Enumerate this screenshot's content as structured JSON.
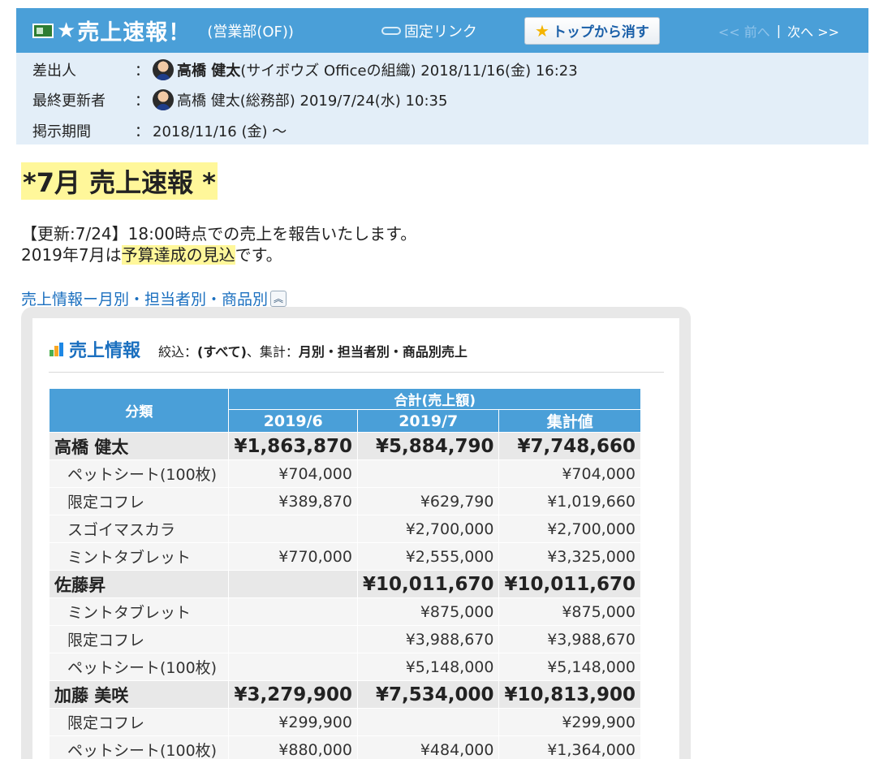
{
  "header": {
    "star": "★",
    "title": "売上速報！",
    "dept": "(営業部(OF))",
    "permalink": "固定リンク",
    "remove_button": "トップから消す",
    "prev": "<< 前へ",
    "separator": "|",
    "next": "次へ >>"
  },
  "meta": {
    "sender_label": "差出人",
    "sender_name": "高橋 健太",
    "sender_detail": "(サイボウズ Officeの組織) 2018/11/16(金) 16:23",
    "updater_label": "最終更新者",
    "updater_detail": "高橋 健太(総務部) 2019/7/24(水) 10:35",
    "period_label": "掲示期間",
    "period_value": "2018/11/16 (金) 〜",
    "colon": "："
  },
  "body": {
    "headline": "*7月 売上速報 *",
    "line1": "【更新:7/24】18:00時点での売上を報告いたします。",
    "line2_prefix": "2019年7月は",
    "line2_highlight": "予算達成の見込",
    "line2_suffix": "です。",
    "section_link": "売上情報ー月別・担当者別・商品別"
  },
  "panel": {
    "title": "売上情報",
    "filter_label": "絞込：",
    "filter_value": "(すべて)",
    "agg_label": "、集計：",
    "agg_value": "月別・担当者別・商品別売上"
  },
  "table": {
    "cat_header": "分類",
    "group_header": "合計(売上額)",
    "columns": [
      "2019/6",
      "2019/7",
      "集計値"
    ],
    "rows": [
      {
        "type": "person",
        "label": "高橋 健太",
        "v": [
          "¥1,863,870",
          "¥5,884,790",
          "¥7,748,660"
        ]
      },
      {
        "type": "item",
        "label": "ペットシート(100枚)",
        "v": [
          "¥704,000",
          "",
          "¥704,000"
        ]
      },
      {
        "type": "item",
        "label": "限定コフレ",
        "v": [
          "¥389,870",
          "¥629,790",
          "¥1,019,660"
        ]
      },
      {
        "type": "item",
        "label": "スゴイマスカラ",
        "v": [
          "",
          "¥2,700,000",
          "¥2,700,000"
        ]
      },
      {
        "type": "item",
        "label": "ミントタブレット",
        "v": [
          "¥770,000",
          "¥2,555,000",
          "¥3,325,000"
        ]
      },
      {
        "type": "person",
        "label": "佐藤昇",
        "v": [
          "",
          "¥10,011,670",
          "¥10,011,670"
        ]
      },
      {
        "type": "item",
        "label": "ミントタブレット",
        "v": [
          "",
          "¥875,000",
          "¥875,000"
        ]
      },
      {
        "type": "item",
        "label": "限定コフレ",
        "v": [
          "",
          "¥3,988,670",
          "¥3,988,670"
        ]
      },
      {
        "type": "item",
        "label": "ペットシート(100枚)",
        "v": [
          "",
          "¥5,148,000",
          "¥5,148,000"
        ]
      },
      {
        "type": "person",
        "label": "加藤 美咲",
        "v": [
          "¥3,279,900",
          "¥7,534,000",
          "¥10,813,900"
        ]
      },
      {
        "type": "item",
        "label": "限定コフレ",
        "v": [
          "¥299,900",
          "",
          "¥299,900"
        ]
      },
      {
        "type": "item",
        "label": "ペットシート(100枚)",
        "v": [
          "¥880,000",
          "¥484,000",
          "¥1,364,000"
        ]
      }
    ]
  }
}
